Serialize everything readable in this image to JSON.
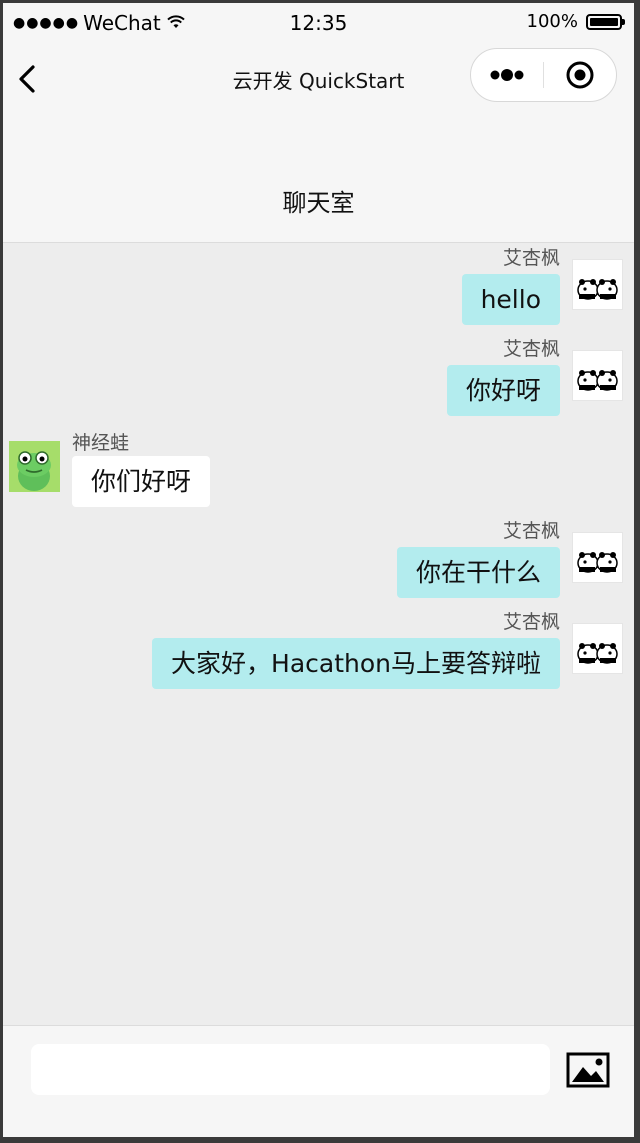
{
  "status_bar": {
    "signal": "●●●●●",
    "carrier": "WeChat",
    "time": "12:35",
    "battery": "100%"
  },
  "nav": {
    "app_title": "云开发 QuickStart",
    "room_title": "聊天室"
  },
  "messages": [
    {
      "side": "right",
      "name": "艾杏枫",
      "text": "hello",
      "avatar": "panda-avatar"
    },
    {
      "side": "right",
      "name": "艾杏枫",
      "text": "你好呀",
      "avatar": "panda-avatar"
    },
    {
      "side": "left",
      "name": "神经蛙",
      "text": "你们好呀",
      "avatar": "frog-avatar"
    },
    {
      "side": "right",
      "name": "艾杏枫",
      "text": "你在干什么",
      "avatar": "panda-avatar"
    },
    {
      "side": "right",
      "name": "艾杏枫",
      "text": "大家好，Hacathon马上要答辩啦",
      "avatar": "panda-avatar"
    }
  ],
  "input": {
    "value": "",
    "placeholder": ""
  },
  "icons": {
    "back": "chevron-left-icon",
    "more": "more-dots-icon",
    "close": "target-circle-icon",
    "image": "image-icon"
  },
  "colors": {
    "bubble_self": "#b3ecee",
    "bubble_other": "#ffffff",
    "background": "#ededed",
    "bar": "#f6f6f6"
  }
}
